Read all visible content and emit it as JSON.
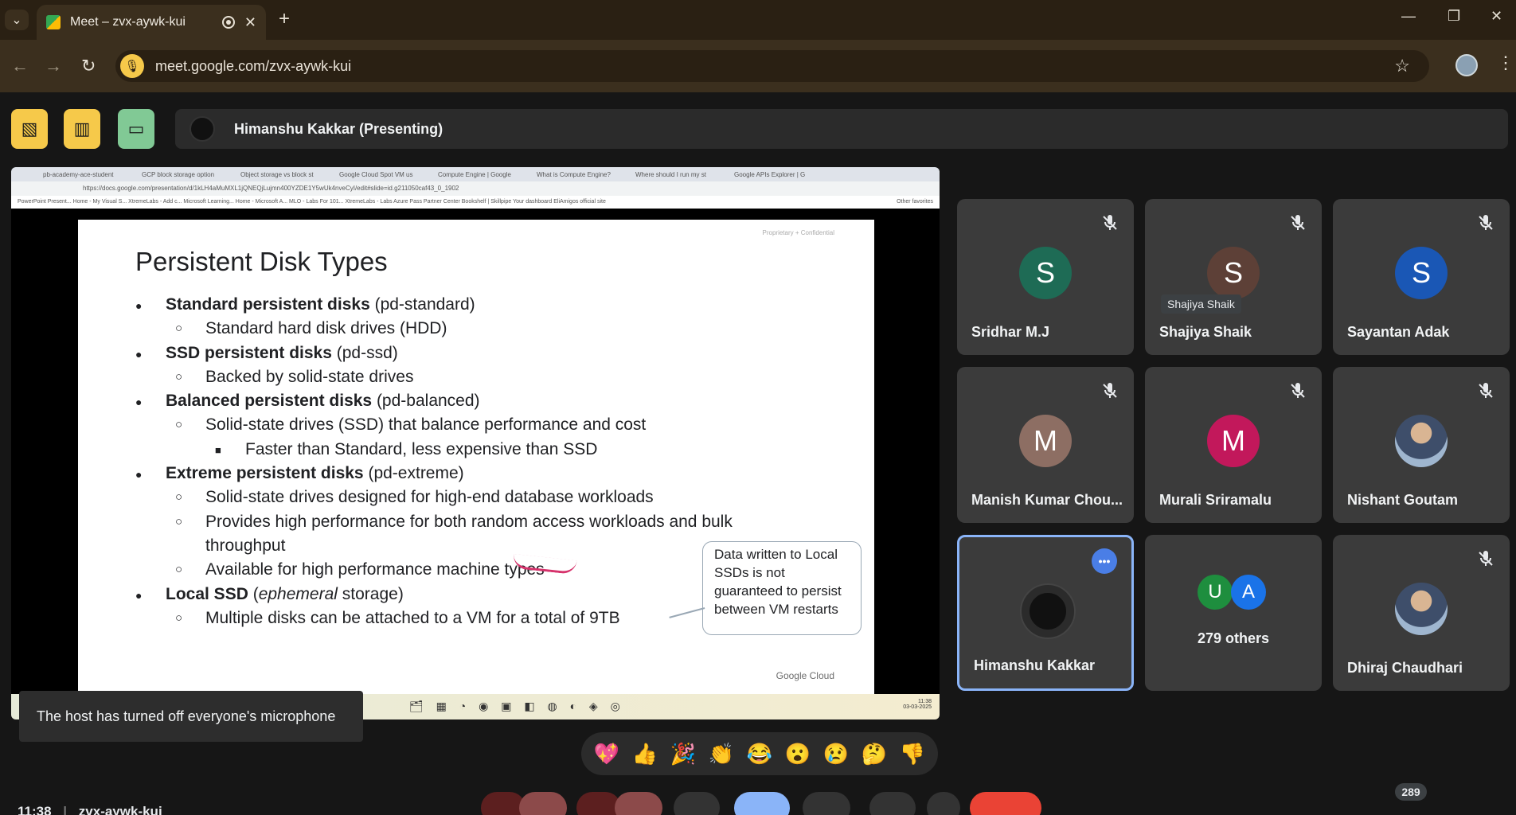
{
  "browser": {
    "tab_title": "Meet – zvx-aywk-kui",
    "url": "meet.google.com/zvx-aywk-kui"
  },
  "meet": {
    "presenter_label": "Himanshu Kakkar (Presenting)",
    "toast": "The host has turned off everyone's microphone",
    "participant_count": "289",
    "meeting_clock": "11:38",
    "meeting_code": "zvx-aywk-kui"
  },
  "shared_screen": {
    "inner_tabs": [
      "pb-academy-ace-student",
      "GCP block storage option",
      "Object storage vs block st",
      "Google Cloud Spot VM us",
      "Compute Engine | Google",
      "What is Compute Engine?",
      "Where should I run my st",
      "Google APIs Explorer | G"
    ],
    "inner_url": "https://docs.google.com/presentation/d/1kLH4aMuMXL1jQNEQjLujmn400YZDE1Y5wUk4nveCyI/edit#slide=id.g211050caf43_0_1902",
    "bookmarks": "PowerPoint Present...   Home - My Visual S...   XtremeLabs - Add c...   Microsoft Learning...   Home - Microsoft A...   MLO - Labs For 101...   XtremeLabs - Labs   Azure Pass   Partner Center   Bookshelf | Skillpipe   Your dashboard   EliAmigos official site",
    "other_favorites": "Other favorites",
    "taskbar_time": "11:38",
    "taskbar_date": "03-03-2025",
    "slide": {
      "confidential": "Proprietary + Confidential",
      "title": "Persistent Disk Types",
      "items": [
        {
          "level": 1,
          "bold": "Standard persistent disks",
          "rest": " (pd-standard)"
        },
        {
          "level": 2,
          "bold": "",
          "rest": "Standard hard disk drives (HDD)"
        },
        {
          "level": 1,
          "bold": "SSD persistent disks",
          "rest": " (pd-ssd)"
        },
        {
          "level": 2,
          "bold": "",
          "rest": "Backed by solid-state drives"
        },
        {
          "level": 1,
          "bold": "Balanced persistent disks",
          "rest": " (pd-balanced)"
        },
        {
          "level": 2,
          "bold": "",
          "rest": "Solid-state drives (SSD) that balance performance and cost"
        },
        {
          "level": 3,
          "bold": "",
          "rest": "Faster than Standard, less expensive than SSD"
        },
        {
          "level": 1,
          "bold": "Extreme persistent disks",
          "rest": " (pd-extreme)"
        },
        {
          "level": 2,
          "bold": "",
          "rest": "Solid-state drives designed for high-end database workloads"
        },
        {
          "level": 2,
          "bold": "",
          "rest": "Provides high performance for both random access workloads and bulk"
        },
        {
          "level": 2,
          "bold": "",
          "rest": "throughput",
          "continuation": true
        },
        {
          "level": 2,
          "bold": "",
          "rest": "Available for high performance machine types"
        },
        {
          "level": 1,
          "bold": "Local SSD",
          "rest": " (ephemeral storage)"
        },
        {
          "level": 2,
          "bold": "",
          "rest": "Multiple disks can be attached to a VM for a total of 9TB"
        }
      ],
      "callout": "Data written to Local SSDs is not guaranteed to persist between VM restarts",
      "footer": "Google Cloud"
    }
  },
  "participants": [
    {
      "name": "Sridhar M.J",
      "initial": "S",
      "color": "#1e6b55",
      "muted": true
    },
    {
      "name": "Shajiya Shaik",
      "initial": "S",
      "color": "#5d4037",
      "muted": true,
      "tooltip": "Shajiya Shaik"
    },
    {
      "name": "Sayantan Adak",
      "initial": "S",
      "color": "#1a57b5",
      "muted": true
    },
    {
      "name": "Manish Kumar Chou...",
      "initial": "M",
      "color": "#8d6e63",
      "muted": true
    },
    {
      "name": "Murali Sriramalu",
      "initial": "M",
      "color": "#c2185b",
      "muted": true
    },
    {
      "name": "Nishant Goutam",
      "initial": "",
      "color": "photo",
      "muted": true
    },
    {
      "name": "Himanshu Kakkar",
      "initial": "",
      "color": "#111111",
      "muted": false,
      "active": true
    },
    {
      "name": "279 others",
      "initial": "",
      "color": "group",
      "muted": false,
      "group": [
        "U",
        "A"
      ]
    },
    {
      "name": "Dhiraj Chaudhari",
      "initial": "",
      "color": "photo",
      "muted": true
    }
  ],
  "reactions": [
    "💖",
    "👍",
    "🎉",
    "👏",
    "😂",
    "😮",
    "😢",
    "🤔",
    "👎"
  ]
}
